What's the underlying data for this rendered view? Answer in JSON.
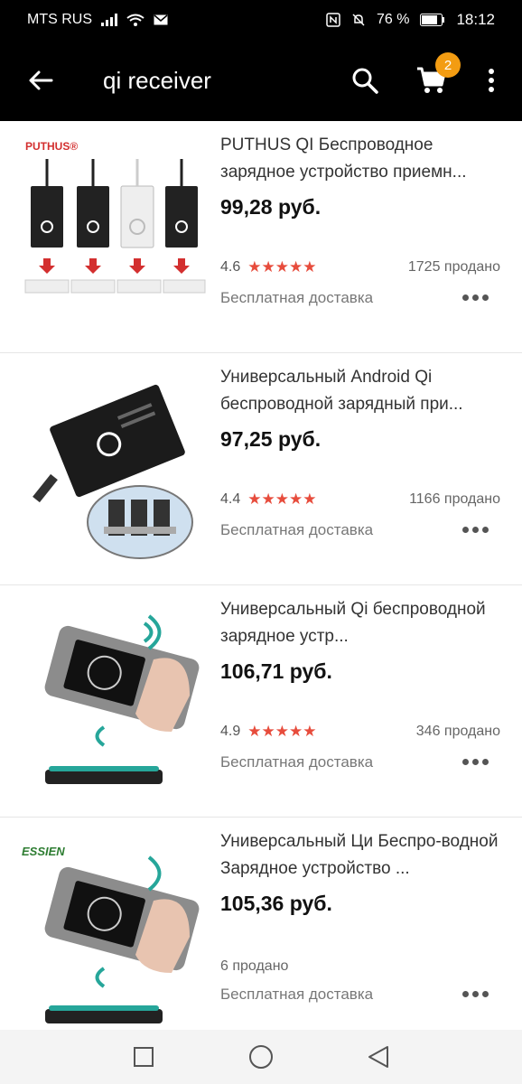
{
  "status": {
    "carrier": "MTS RUS",
    "battery": "76 %",
    "time": "18:12"
  },
  "toolbar": {
    "query": "qi receiver",
    "cart_count": "2"
  },
  "products": [
    {
      "title": "PUTHUS QI Беспроводное зарядное устройство приемн...",
      "price": "99,28 руб.",
      "rating": "4.6",
      "stars": "★★★★★",
      "sold": "1725 продано",
      "delivery": "Бесплатная доставка",
      "brand": "PUTHUS®"
    },
    {
      "title": "Универсальный Android Qi беспроводной зарядный при...",
      "price": "97,25 руб.",
      "rating": "4.4",
      "stars": "★★★★★",
      "sold": "1166 продано",
      "delivery": "Бесплатная доставка"
    },
    {
      "title": "Универсальный Qi беспроводной зарядное устр...",
      "price": "106,71 руб.",
      "rating": "4.9",
      "stars": "★★★★★",
      "sold": "346 продано",
      "delivery": "Бесплатная доставка"
    },
    {
      "title": "Универсальный Ци Беспро-водной Зарядное устройство ...",
      "price": "105,36 руб.",
      "sold": "6 продано",
      "delivery": "Бесплатная доставка",
      "brand": "ESSIEN"
    }
  ],
  "colors": {
    "accent_star": "#e74c3c",
    "badge": "#f39c12",
    "toolbar": "#000000"
  },
  "icons": {
    "back": "arrow-left-icon",
    "search": "search-icon",
    "cart": "cart-icon",
    "menu": "overflow-menu-icon"
  }
}
